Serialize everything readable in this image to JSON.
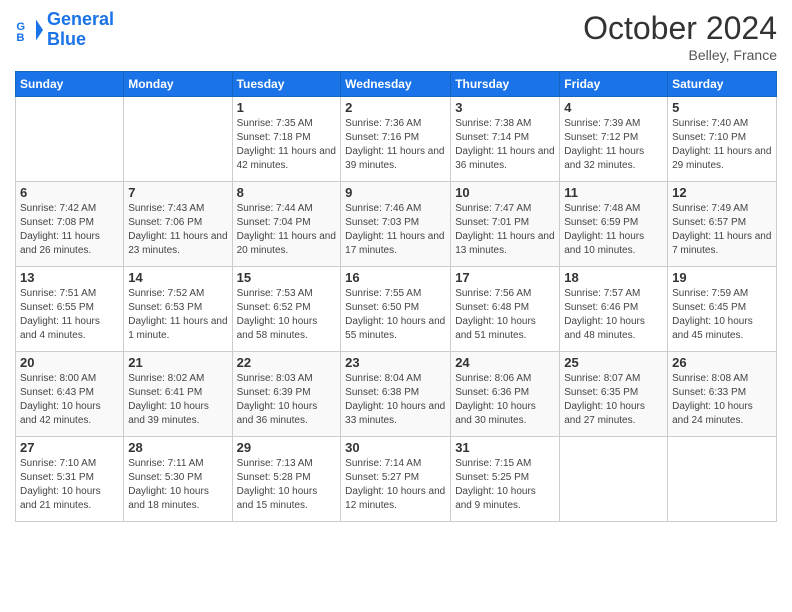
{
  "header": {
    "logo_line1": "General",
    "logo_line2": "Blue",
    "month": "October 2024",
    "location": "Belley, France"
  },
  "weekdays": [
    "Sunday",
    "Monday",
    "Tuesday",
    "Wednesday",
    "Thursday",
    "Friday",
    "Saturday"
  ],
  "weeks": [
    [
      {
        "day": "",
        "info": ""
      },
      {
        "day": "",
        "info": ""
      },
      {
        "day": "1",
        "info": "Sunrise: 7:35 AM\nSunset: 7:18 PM\nDaylight: 11 hours and 42 minutes."
      },
      {
        "day": "2",
        "info": "Sunrise: 7:36 AM\nSunset: 7:16 PM\nDaylight: 11 hours and 39 minutes."
      },
      {
        "day": "3",
        "info": "Sunrise: 7:38 AM\nSunset: 7:14 PM\nDaylight: 11 hours and 36 minutes."
      },
      {
        "day": "4",
        "info": "Sunrise: 7:39 AM\nSunset: 7:12 PM\nDaylight: 11 hours and 32 minutes."
      },
      {
        "day": "5",
        "info": "Sunrise: 7:40 AM\nSunset: 7:10 PM\nDaylight: 11 hours and 29 minutes."
      }
    ],
    [
      {
        "day": "6",
        "info": "Sunrise: 7:42 AM\nSunset: 7:08 PM\nDaylight: 11 hours and 26 minutes."
      },
      {
        "day": "7",
        "info": "Sunrise: 7:43 AM\nSunset: 7:06 PM\nDaylight: 11 hours and 23 minutes."
      },
      {
        "day": "8",
        "info": "Sunrise: 7:44 AM\nSunset: 7:04 PM\nDaylight: 11 hours and 20 minutes."
      },
      {
        "day": "9",
        "info": "Sunrise: 7:46 AM\nSunset: 7:03 PM\nDaylight: 11 hours and 17 minutes."
      },
      {
        "day": "10",
        "info": "Sunrise: 7:47 AM\nSunset: 7:01 PM\nDaylight: 11 hours and 13 minutes."
      },
      {
        "day": "11",
        "info": "Sunrise: 7:48 AM\nSunset: 6:59 PM\nDaylight: 11 hours and 10 minutes."
      },
      {
        "day": "12",
        "info": "Sunrise: 7:49 AM\nSunset: 6:57 PM\nDaylight: 11 hours and 7 minutes."
      }
    ],
    [
      {
        "day": "13",
        "info": "Sunrise: 7:51 AM\nSunset: 6:55 PM\nDaylight: 11 hours and 4 minutes."
      },
      {
        "day": "14",
        "info": "Sunrise: 7:52 AM\nSunset: 6:53 PM\nDaylight: 11 hours and 1 minute."
      },
      {
        "day": "15",
        "info": "Sunrise: 7:53 AM\nSunset: 6:52 PM\nDaylight: 10 hours and 58 minutes."
      },
      {
        "day": "16",
        "info": "Sunrise: 7:55 AM\nSunset: 6:50 PM\nDaylight: 10 hours and 55 minutes."
      },
      {
        "day": "17",
        "info": "Sunrise: 7:56 AM\nSunset: 6:48 PM\nDaylight: 10 hours and 51 minutes."
      },
      {
        "day": "18",
        "info": "Sunrise: 7:57 AM\nSunset: 6:46 PM\nDaylight: 10 hours and 48 minutes."
      },
      {
        "day": "19",
        "info": "Sunrise: 7:59 AM\nSunset: 6:45 PM\nDaylight: 10 hours and 45 minutes."
      }
    ],
    [
      {
        "day": "20",
        "info": "Sunrise: 8:00 AM\nSunset: 6:43 PM\nDaylight: 10 hours and 42 minutes."
      },
      {
        "day": "21",
        "info": "Sunrise: 8:02 AM\nSunset: 6:41 PM\nDaylight: 10 hours and 39 minutes."
      },
      {
        "day": "22",
        "info": "Sunrise: 8:03 AM\nSunset: 6:39 PM\nDaylight: 10 hours and 36 minutes."
      },
      {
        "day": "23",
        "info": "Sunrise: 8:04 AM\nSunset: 6:38 PM\nDaylight: 10 hours and 33 minutes."
      },
      {
        "day": "24",
        "info": "Sunrise: 8:06 AM\nSunset: 6:36 PM\nDaylight: 10 hours and 30 minutes."
      },
      {
        "day": "25",
        "info": "Sunrise: 8:07 AM\nSunset: 6:35 PM\nDaylight: 10 hours and 27 minutes."
      },
      {
        "day": "26",
        "info": "Sunrise: 8:08 AM\nSunset: 6:33 PM\nDaylight: 10 hours and 24 minutes."
      }
    ],
    [
      {
        "day": "27",
        "info": "Sunrise: 7:10 AM\nSunset: 5:31 PM\nDaylight: 10 hours and 21 minutes."
      },
      {
        "day": "28",
        "info": "Sunrise: 7:11 AM\nSunset: 5:30 PM\nDaylight: 10 hours and 18 minutes."
      },
      {
        "day": "29",
        "info": "Sunrise: 7:13 AM\nSunset: 5:28 PM\nDaylight: 10 hours and 15 minutes."
      },
      {
        "day": "30",
        "info": "Sunrise: 7:14 AM\nSunset: 5:27 PM\nDaylight: 10 hours and 12 minutes."
      },
      {
        "day": "31",
        "info": "Sunrise: 7:15 AM\nSunset: 5:25 PM\nDaylight: 10 hours and 9 minutes."
      },
      {
        "day": "",
        "info": ""
      },
      {
        "day": "",
        "info": ""
      }
    ]
  ]
}
